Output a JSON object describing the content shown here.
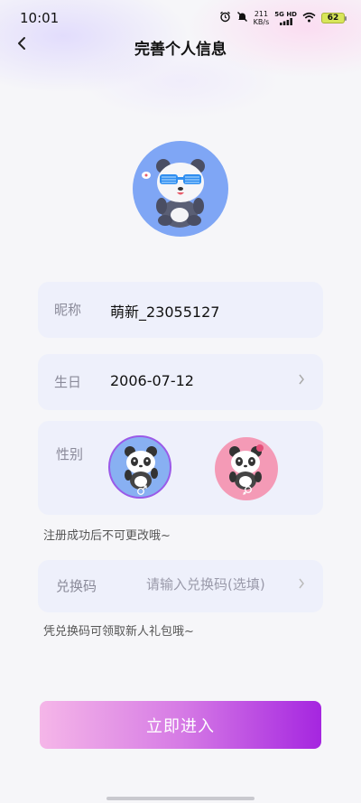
{
  "status_bar": {
    "time": "10:01",
    "speed_value": "211",
    "speed_unit": "KB/s",
    "signal_label": "5G HD",
    "battery": "62",
    "icons": [
      "alarm-icon",
      "mute-icon",
      "signal-icon",
      "wifi-icon",
      "battery-icon"
    ]
  },
  "header": {
    "back_icon": "back-chevron-icon",
    "title": "完善个人信息"
  },
  "avatar": {
    "icon": "panda-with-sunglasses-avatar",
    "bg_color": "#7fa6f5"
  },
  "form": {
    "nickname": {
      "label": "昵称",
      "value": "萌新_23055127"
    },
    "birthday": {
      "label": "生日",
      "value": "2006-07-12"
    },
    "gender": {
      "label": "性别",
      "options": [
        {
          "id": "male",
          "icon": "male-symbol-icon",
          "selected": true
        },
        {
          "id": "female",
          "icon": "female-symbol-icon",
          "selected": false
        }
      ],
      "hint": "注册成功后不可更改哦~"
    },
    "redeem_code": {
      "label": "兑换码",
      "placeholder": "请输入兑换码(选填)",
      "value": "",
      "hint": "凭兑换码可领取新人礼包哦~"
    }
  },
  "submit": {
    "label": "立即进入"
  },
  "colors": {
    "accent_start": "#f5b6e8",
    "accent_end": "#a526e0",
    "card_bg": "#eef0fb",
    "male_bg": "#88b0f2",
    "female_bg": "#f49ab6"
  }
}
